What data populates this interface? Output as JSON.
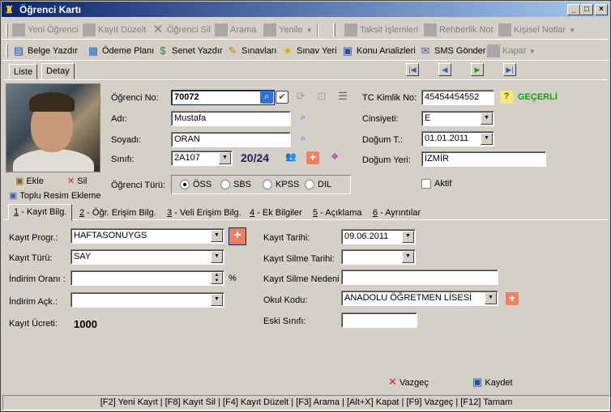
{
  "window": {
    "title": "Öğrenci Kartı"
  },
  "toolbar1": {
    "new_student": "Yeni Öğrenci",
    "edit_record": "Kayıt Düzelt",
    "delete_student": "Öğrenci Sil",
    "search": "Arama",
    "refresh": "Yenile",
    "installments": "Taksit İşlemleri",
    "guidance_note": "Rehberlik Not",
    "personal_notes": "Kişisel Notlar"
  },
  "toolbar2": {
    "print_document": "Belge Yazdır",
    "payment_plan": "Ödeme Planı",
    "print_bond": "Senet Yazdır",
    "exams": "Sınavları",
    "exam_place": "Sınav Yeri",
    "topic_analysis": "Konu Analizleri",
    "sms_send": "SMS Gönder",
    "close": "Kapat"
  },
  "tabs": {
    "list": "Liste",
    "detail": "Detay"
  },
  "photo_actions": {
    "add": "Ekle",
    "delete": "Sil",
    "bulk": "Toplu Resim Ekleme"
  },
  "form": {
    "student_no_label": "Öğrenci No:",
    "student_no": "70072",
    "name_label": "Adı:",
    "name": "Mustafa",
    "surname_label": "Soyadı:",
    "surname": "ORAN",
    "class_label": "Sınıfı:",
    "class": "2A107",
    "class_count": "20/24",
    "student_type_label": "Öğrenci Türü:",
    "student_types": [
      "ÖSS",
      "SBS",
      "KPSS",
      "DIL"
    ],
    "tc_label": "TC Kimlik No:",
    "tc": "45454454552",
    "tc_status": "GEÇERLİ",
    "gender_label": "Cinsiyeti:",
    "gender": "E",
    "birth_date_label": "Doğum T.:",
    "birth_date": "01.01.2011",
    "birth_place_label": "Doğum Yeri:",
    "birth_place": "İZMİR",
    "active_label": "Aktif"
  },
  "subtabs": [
    {
      "key": "1",
      "label": " - Kayıt Bilg."
    },
    {
      "key": "2",
      "label": " - Öğr. Erişim Bilg."
    },
    {
      "key": "3",
      "label": " - Veli Erişim Bilg."
    },
    {
      "key": "4",
      "label": " - Ek Bilgiler"
    },
    {
      "key": "5",
      "label": " - Açıklama"
    },
    {
      "key": "6",
      "label": " - Ayrıntılar"
    }
  ],
  "registration": {
    "program_label": "Kayıt Progr.:",
    "program": "HAFTASONUYGS",
    "type_label": "Kayıt Türü:",
    "type": "SAY",
    "discount_label": "İndirim Oranı :",
    "discount": "",
    "percent": "%",
    "discount_desc_label": "İndirim Açk.:",
    "discount_desc": "",
    "fee_label": "Kayıt Ücreti:",
    "fee": "1000",
    "date_label": "Kayıt Tarihi:",
    "date": "09.06.2011",
    "delete_date_label": "Kayıt Silme Tarihi:",
    "delete_date": "",
    "delete_reason_label": "Kayıt Silme Nedeni :",
    "delete_reason": "",
    "school_label": "Okul Kodu:",
    "school": "ANADOLU ÖĞRETMEN LİSESİ",
    "old_class_label": "Eski Sınıfı:",
    "old_class": ""
  },
  "actions": {
    "cancel": "Vazgeç",
    "save": "Kaydet"
  },
  "statusbar": {
    "text": "[F2] Yeni Kayıt | [F8] Kayıt Sil | [F4] Kayıt Düzelt | [F3] Arama | [Alt+X] Kapat | [F9] Vazgeç | [F12] Tamam"
  }
}
